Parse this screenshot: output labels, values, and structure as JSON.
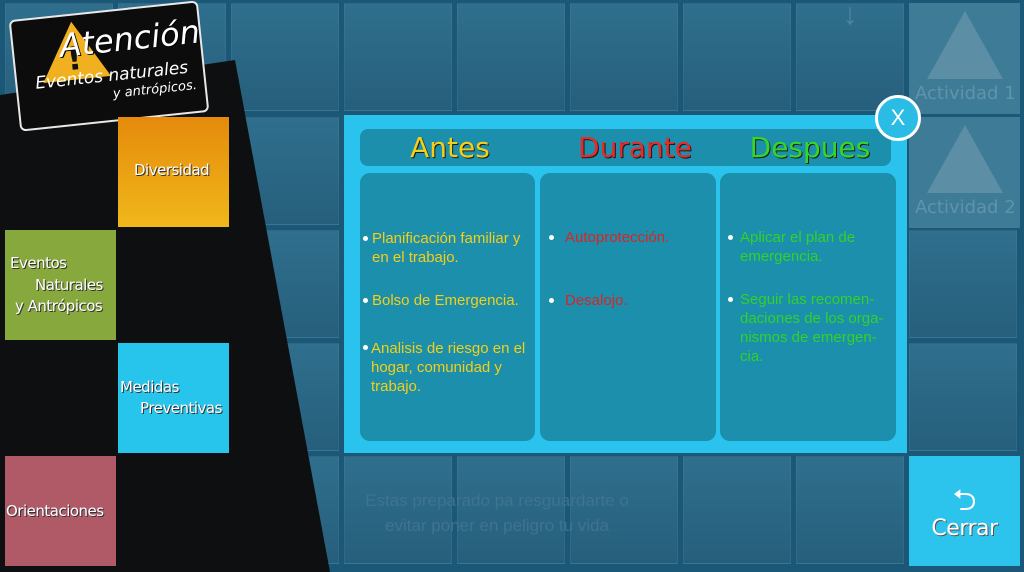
{
  "logo": {
    "title": "Atención",
    "subtitle_line1": "Eventos naturales",
    "subtitle_line2": "y antrópicos."
  },
  "menu": {
    "diversidad": "Diversidad",
    "eventos": [
      "Eventos",
      "Naturales",
      "y Antrópicos"
    ],
    "medidas": [
      "Medidas",
      "Preventivas"
    ],
    "orientaciones": "Orientaciones"
  },
  "activities": {
    "act1": "Actividad 1",
    "act2": "Actividad 2"
  },
  "background_text": {
    "line1": "Estas preparado pa resguardarte o",
    "line2": "evitar poner en peligro tu vida"
  },
  "dialog": {
    "headers": {
      "antes": "Antes",
      "durante": "Durante",
      "despues": "Despues"
    },
    "antes": [
      "Planificación familiar y\nen el trabajo.",
      "Bolso de Emergencia.",
      "Analisis de riesgo en el\nhogar, comunidad y\ntrabajo."
    ],
    "durante": [
      "Autoprotección.",
      "Desalojo."
    ],
    "despues": [
      "Aplicar el plan de\nemergencia.",
      "Seguir las recomen-\ndaciones de los orga-\nnismos de emergen-\ncia."
    ],
    "close_label": "X"
  },
  "cerrar": {
    "icon": "⮌",
    "label": "Cerrar"
  },
  "colors": {
    "dialog_bg": "#29c3ed",
    "antes": "#f4cf18",
    "durante": "#e62a2a",
    "despues": "#35d625"
  }
}
